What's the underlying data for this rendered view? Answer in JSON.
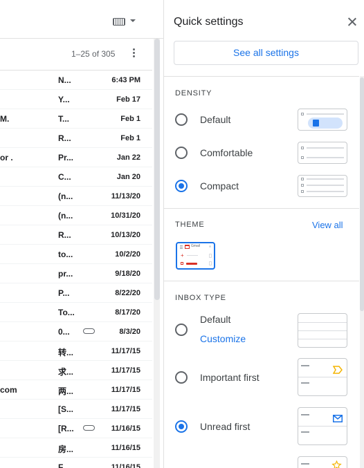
{
  "mail": {
    "range_label": "1–25 of 305",
    "rows": [
      {
        "sender": "",
        "subject": "N...",
        "date": "6:43 PM",
        "attachment": false
      },
      {
        "sender": "",
        "subject": "Y...",
        "date": "Feb 17",
        "attachment": false
      },
      {
        "sender": "M.",
        "subject": "T...",
        "date": "Feb 1",
        "attachment": false
      },
      {
        "sender": "",
        "subject": "R...",
        "date": "Feb 1",
        "attachment": false
      },
      {
        "sender": "or .",
        "subject": "Pr...",
        "date": "Jan 22",
        "attachment": false
      },
      {
        "sender": "",
        "subject": "C...",
        "date": "Jan 20",
        "attachment": false
      },
      {
        "sender": "",
        "subject": "(n...",
        "date": "11/13/20",
        "attachment": false
      },
      {
        "sender": "",
        "subject": "(n...",
        "date": "10/31/20",
        "attachment": false
      },
      {
        "sender": "",
        "subject": "R...",
        "date": "10/13/20",
        "attachment": false
      },
      {
        "sender": "",
        "subject": "to...",
        "date": "10/2/20",
        "attachment": false
      },
      {
        "sender": "",
        "subject": "pr...",
        "date": "9/18/20",
        "attachment": false
      },
      {
        "sender": "",
        "subject": "P...",
        "date": "8/22/20",
        "attachment": false
      },
      {
        "sender": "",
        "subject": "To...",
        "date": "8/17/20",
        "attachment": false
      },
      {
        "sender": "",
        "subject": "0...",
        "date": "8/3/20",
        "attachment": true
      },
      {
        "sender": "",
        "subject": "转...",
        "date": "11/17/15",
        "attachment": false
      },
      {
        "sender": "",
        "subject": "求...",
        "date": "11/17/15",
        "attachment": false
      },
      {
        "sender": "com",
        "subject": "两...",
        "date": "11/17/15",
        "attachment": false
      },
      {
        "sender": "",
        "subject": "[S...",
        "date": "11/17/15",
        "attachment": false
      },
      {
        "sender": "",
        "subject": "[R...",
        "date": "11/16/15",
        "attachment": true
      },
      {
        "sender": "",
        "subject": "房...",
        "date": "11/16/15",
        "attachment": false
      },
      {
        "sender": "",
        "subject": "F...",
        "date": "11/16/15",
        "attachment": false
      }
    ]
  },
  "quick_settings": {
    "title": "Quick settings",
    "see_all_label": "See all settings",
    "density": {
      "heading": "DENSITY",
      "options": [
        {
          "label": "Default",
          "selected": false
        },
        {
          "label": "Comfortable",
          "selected": false
        },
        {
          "label": "Compact",
          "selected": true
        }
      ]
    },
    "theme": {
      "heading": "THEME",
      "view_all_label": "View all",
      "thumb_brand": "Gmail"
    },
    "inbox_type": {
      "heading": "INBOX TYPE",
      "options": [
        {
          "label": "Default",
          "selected": false,
          "link": "Customize"
        },
        {
          "label": "Important first",
          "selected": false
        },
        {
          "label": "Unread first",
          "selected": true
        }
      ]
    }
  },
  "colors": {
    "accent": "#1a73e8",
    "important_marker": "#f4b400",
    "star": "#f4b400",
    "theme_red": "#d93025"
  }
}
